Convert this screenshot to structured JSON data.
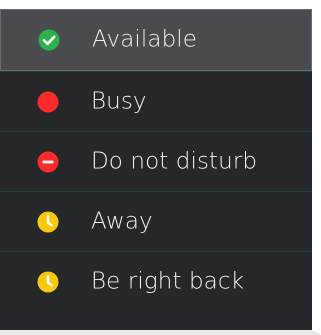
{
  "status_menu": {
    "items": [
      {
        "label": "Available",
        "icon": "check-circle-icon",
        "color": "#2bb24c",
        "selected": true
      },
      {
        "label": "Busy",
        "icon": "red-circle-icon",
        "color": "#ff2b2b",
        "selected": false
      },
      {
        "label": "Do not disturb",
        "icon": "minus-circle-icon",
        "color": "#ff2b2b",
        "selected": false
      },
      {
        "label": "Away",
        "icon": "clock-icon",
        "color": "#f6c90e",
        "selected": false
      },
      {
        "label": "Be right back",
        "icon": "clock-icon",
        "color": "#f6c90e",
        "selected": false
      }
    ]
  }
}
